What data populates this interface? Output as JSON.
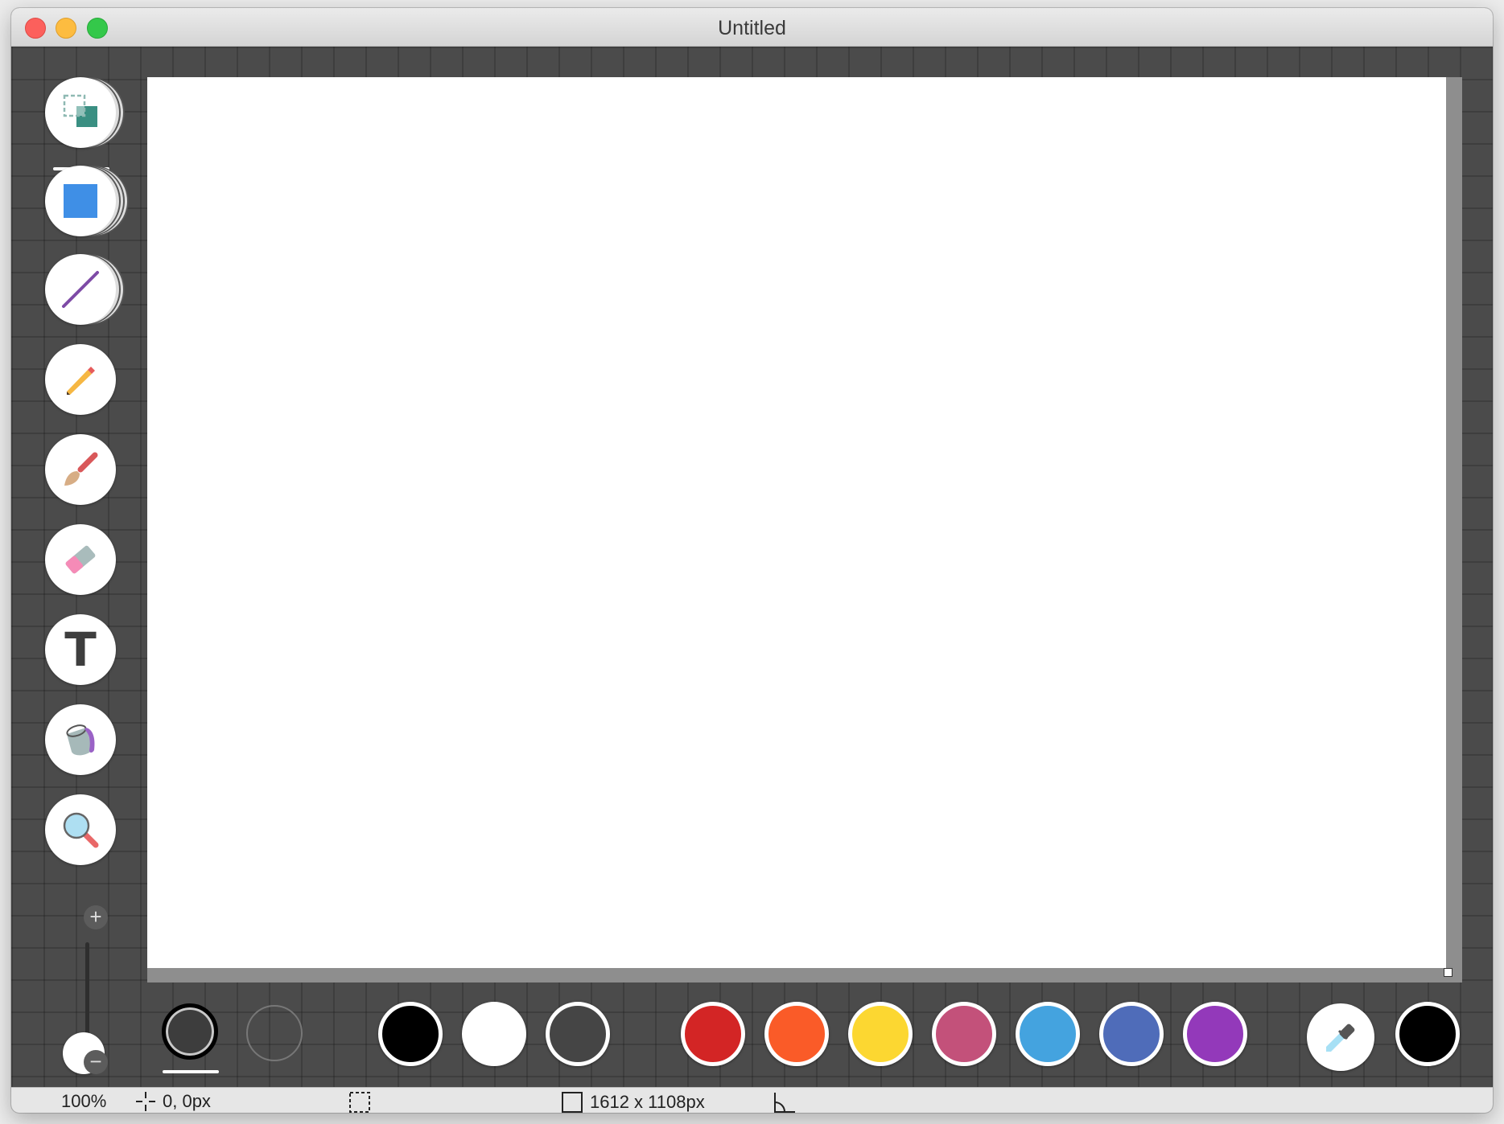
{
  "window": {
    "title": "Untitled"
  },
  "tools": [
    {
      "name": "selection-tool",
      "icon": "selection-icon"
    },
    {
      "name": "shape-tool",
      "icon": "square-shape-icon"
    },
    {
      "name": "line-tool",
      "icon": "line-icon"
    },
    {
      "name": "pencil-tool",
      "icon": "pencil-icon"
    },
    {
      "name": "brush-tool",
      "icon": "brush-icon"
    },
    {
      "name": "eraser-tool",
      "icon": "eraser-icon"
    },
    {
      "name": "text-tool",
      "icon": "text-icon",
      "label": "T"
    },
    {
      "name": "fill-tool",
      "icon": "paint-bucket-icon"
    },
    {
      "name": "zoom-tool",
      "icon": "magnifier-icon"
    }
  ],
  "zoom_controls": {
    "plus": "+",
    "minus": "−"
  },
  "palette": {
    "basic": [
      "#000000",
      "#ffffff",
      "#454545"
    ],
    "colors": [
      "#d32525",
      "#fa5b28",
      "#fcd731",
      "#c3517a",
      "#44a3df",
      "#4f6cb9",
      "#9339ba"
    ],
    "current_color": "#000000"
  },
  "status": {
    "zoom": "100%",
    "cursor": "0, 0px",
    "canvas_size": "1612 x 1108px"
  }
}
